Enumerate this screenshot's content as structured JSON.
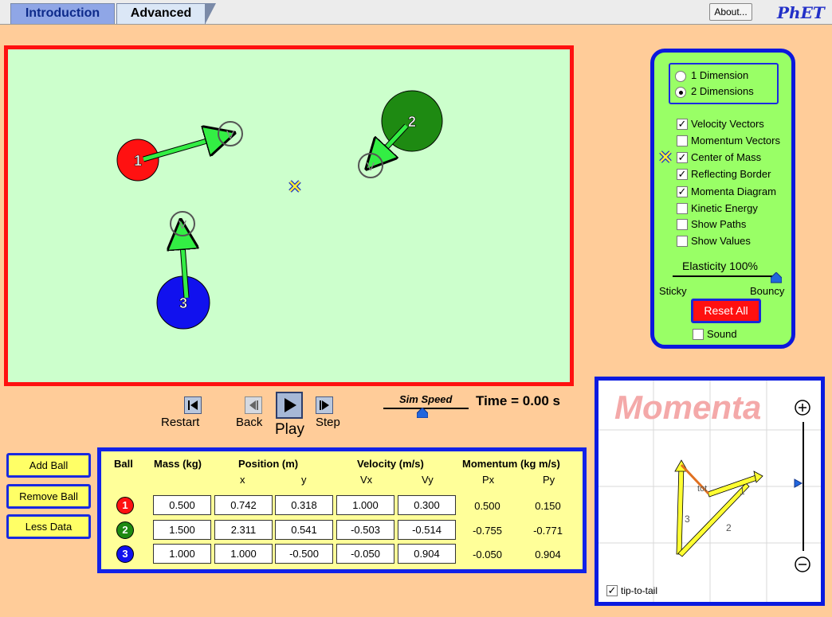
{
  "tabs": {
    "introduction": "Introduction",
    "advanced": "Advanced"
  },
  "header": {
    "about_label": "About...",
    "logo": "PhET"
  },
  "play_area": {
    "balls": [
      {
        "label": "1",
        "color": "#ff1111"
      },
      {
        "label": "2",
        "color": "#1e8a12"
      },
      {
        "label": "3",
        "color": "#1111ee"
      }
    ],
    "velocity_marker_label": "V"
  },
  "playback": {
    "restart": "Restart",
    "back": "Back",
    "play": "Play",
    "step": "Step",
    "sim_speed": "Sim Speed",
    "time": "Time = 0.00 s"
  },
  "control_panel": {
    "dimensions": [
      "1 Dimension",
      "2 Dimensions"
    ],
    "selected_dimension": "2 Dimensions",
    "options": [
      {
        "label": "Velocity Vectors",
        "checked": true
      },
      {
        "label": "Momentum Vectors",
        "checked": false
      },
      {
        "label": "Center of Mass",
        "checked": true
      },
      {
        "label": "Reflecting Border",
        "checked": true
      },
      {
        "label": "Momenta Diagram",
        "checked": true
      },
      {
        "label": "Kinetic Energy",
        "checked": false
      },
      {
        "label": "Show Paths",
        "checked": false
      },
      {
        "label": "Show Values",
        "checked": false
      }
    ],
    "elasticity": "Elasticity 100%",
    "elasticity_value": 1.0,
    "sticky": "Sticky",
    "bouncy": "Bouncy",
    "reset_all": "Reset All",
    "sound": "Sound",
    "sound_checked": false
  },
  "side_buttons": {
    "add_ball": "Add Ball",
    "remove_ball": "Remove Ball",
    "less_data": "Less Data"
  },
  "table": {
    "headers": {
      "ball": "Ball",
      "mass": "Mass (kg)",
      "position": "Position (m)",
      "velocity": "Velocity (m/s)",
      "momentum": "Momentum (kg m/s)"
    },
    "subheaders": {
      "x": "x",
      "y": "y",
      "vx": "Vx",
      "vy": "Vy",
      "px": "Px",
      "py": "Py"
    },
    "rows": [
      {
        "ball": "1",
        "color": "#ff1111",
        "mass": "0.500",
        "x": "0.742",
        "y": "0.318",
        "vx": "1.000",
        "vy": "0.300",
        "px": "0.500",
        "py": "0.150"
      },
      {
        "ball": "2",
        "color": "#1e8a12",
        "mass": "1.500",
        "x": "2.311",
        "y": "0.541",
        "vx": "-0.503",
        "vy": "-0.514",
        "px": "-0.755",
        "py": "-0.771"
      },
      {
        "ball": "3",
        "color": "#1111ee",
        "mass": "1.000",
        "x": "1.000",
        "y": "-0.500",
        "vx": "-0.050",
        "vy": "0.904",
        "px": "-0.050",
        "py": "0.904"
      }
    ]
  },
  "momenta_panel": {
    "title": "Momenta",
    "labels": {
      "tot": "tot",
      "one": "1",
      "two": "2",
      "three": "3"
    },
    "zoom_in": "⊕",
    "zoom_out": "⊖",
    "tip_to_tail": "tip-to-tail",
    "tip_to_tail_checked": true
  },
  "colors": {
    "background": "#ffcc99",
    "play_area": "#ccffcc",
    "play_border": "#ff1010",
    "panel": "#99ff66",
    "panel_border": "#0b18dd",
    "table_bg": "#ffff99",
    "velocity_arrow": "#33ee44"
  }
}
